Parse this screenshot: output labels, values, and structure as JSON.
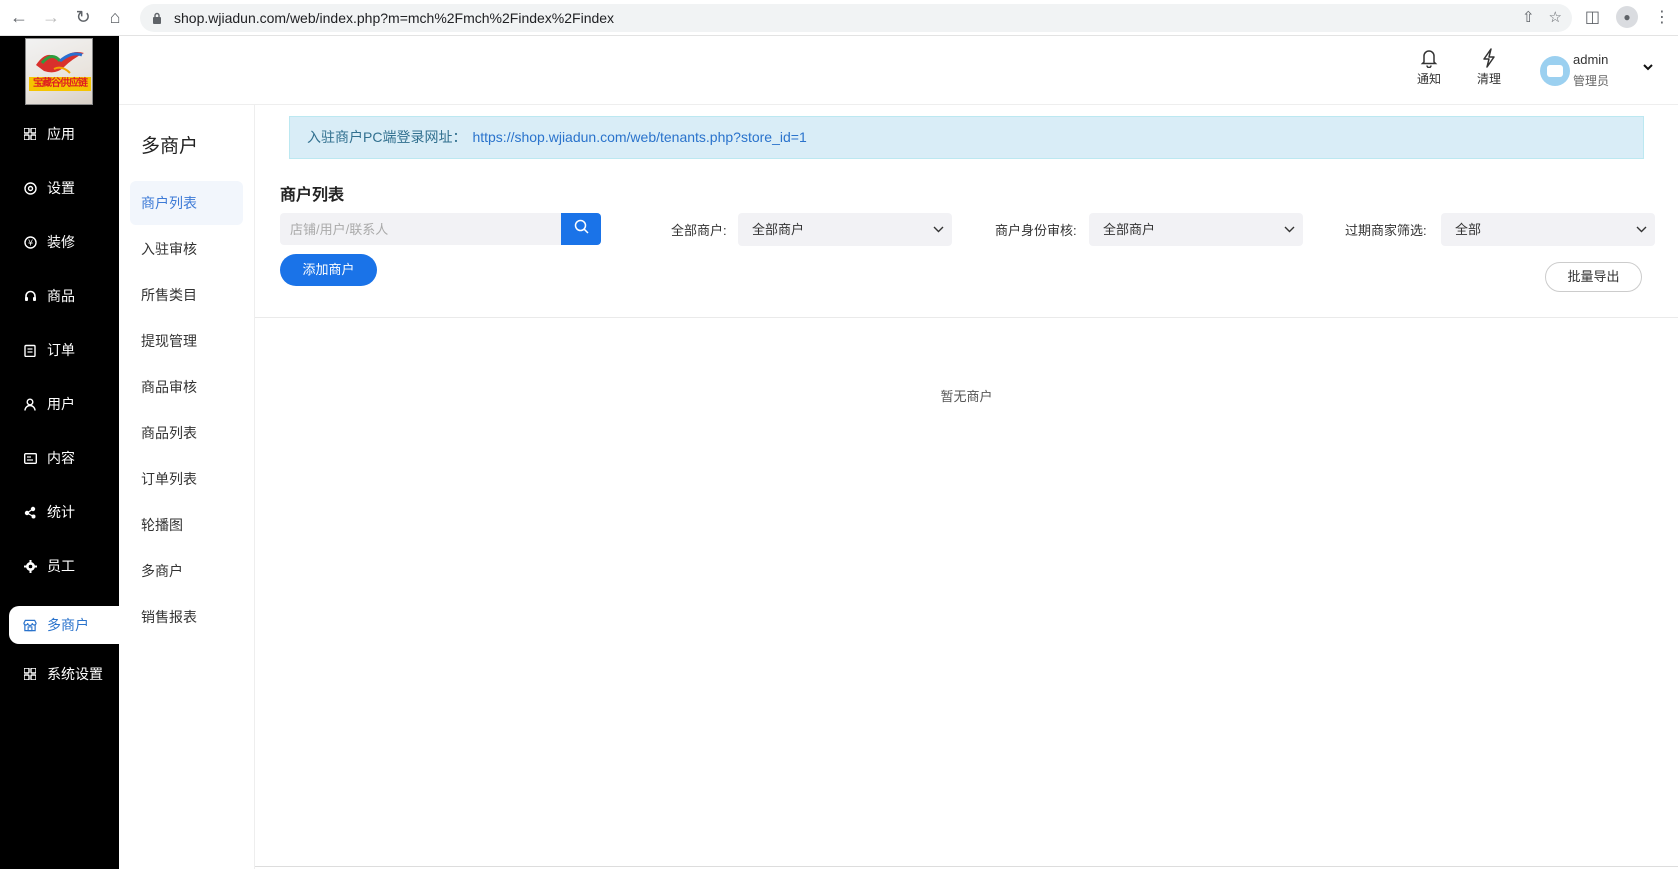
{
  "browser": {
    "url": "shop.wjiadun.com/web/index.php?m=mch%2Fmch%2Findex%2Findex"
  },
  "logo": {
    "text": "宝藏谷供应链"
  },
  "sidebar": {
    "items": [
      {
        "label": "应用",
        "icon": "grid-icon"
      },
      {
        "label": "设置",
        "icon": "gear-icon"
      },
      {
        "label": "装修",
        "icon": "yen-circle-icon"
      },
      {
        "label": "商品",
        "icon": "headset-icon"
      },
      {
        "label": "订单",
        "icon": "clipboard-icon"
      },
      {
        "label": "用户",
        "icon": "user-icon"
      },
      {
        "label": "内容",
        "icon": "document-icon"
      },
      {
        "label": "统计",
        "icon": "chart-icon"
      },
      {
        "label": "员工",
        "icon": "cog-icon"
      },
      {
        "label": "多商户",
        "icon": "store-icon",
        "active": true
      },
      {
        "label": "系统设置",
        "icon": "grid-icon"
      }
    ]
  },
  "header": {
    "notify_label": "通知",
    "clear_label": "清理",
    "user_name": "admin",
    "user_role": "管理员"
  },
  "submenu": {
    "title": "多商户",
    "items": [
      {
        "label": "商户列表",
        "active": true
      },
      {
        "label": "入驻审核"
      },
      {
        "label": "所售类目"
      },
      {
        "label": "提现管理"
      },
      {
        "label": "商品审核"
      },
      {
        "label": "商品列表"
      },
      {
        "label": "订单列表"
      },
      {
        "label": "轮播图"
      },
      {
        "label": "多商户"
      },
      {
        "label": "销售报表"
      }
    ]
  },
  "main": {
    "notice_label": "入驻商户PC端登录网址：",
    "notice_link": "https://shop.wjiadun.com/web/tenants.php?store_id=1",
    "list_title": "商户列表",
    "search_placeholder": "店铺/用户/联系人",
    "filter1_label": "全部商户:",
    "filter1_value": "全部商户",
    "filter2_label": "商户身份审核:",
    "filter2_value": "全部商户",
    "filter3_label": "过期商家筛选:",
    "filter3_value": "全部",
    "add_button": "添加商户",
    "export_button": "批量导出",
    "empty_text": "暂无商户"
  }
}
